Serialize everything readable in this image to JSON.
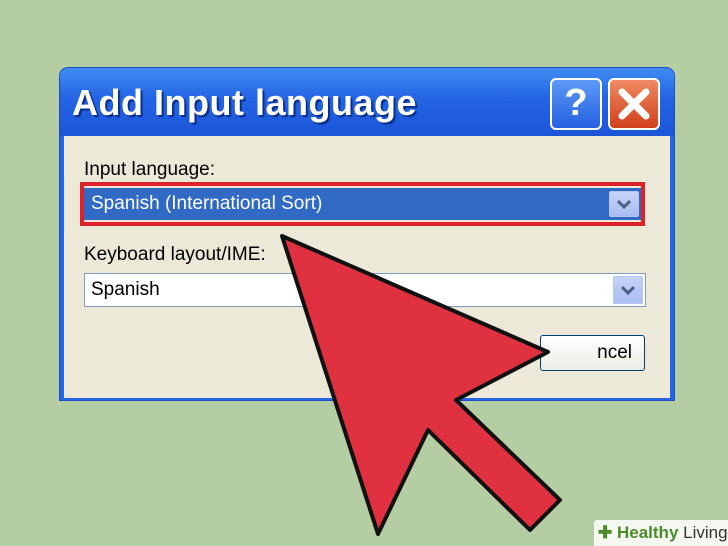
{
  "dialog": {
    "title": "Add Input language",
    "help_glyph": "?",
    "close_icon": "close-icon",
    "input_language_label": "Input language:",
    "input_language_value": "Spanish (International Sort)",
    "keyboard_layout_label": "Keyboard layout/IME:",
    "keyboard_layout_value": "Spanish",
    "cancel_label": "ncel"
  },
  "watermark": {
    "brand_bold": "Healthy",
    "brand_rest": " Living"
  },
  "colors": {
    "background": "#b5cda2",
    "titlebar": "#2466e6",
    "selection": "#316ac5",
    "highlight_frame": "#e0202b",
    "arrow": "#e03140"
  }
}
